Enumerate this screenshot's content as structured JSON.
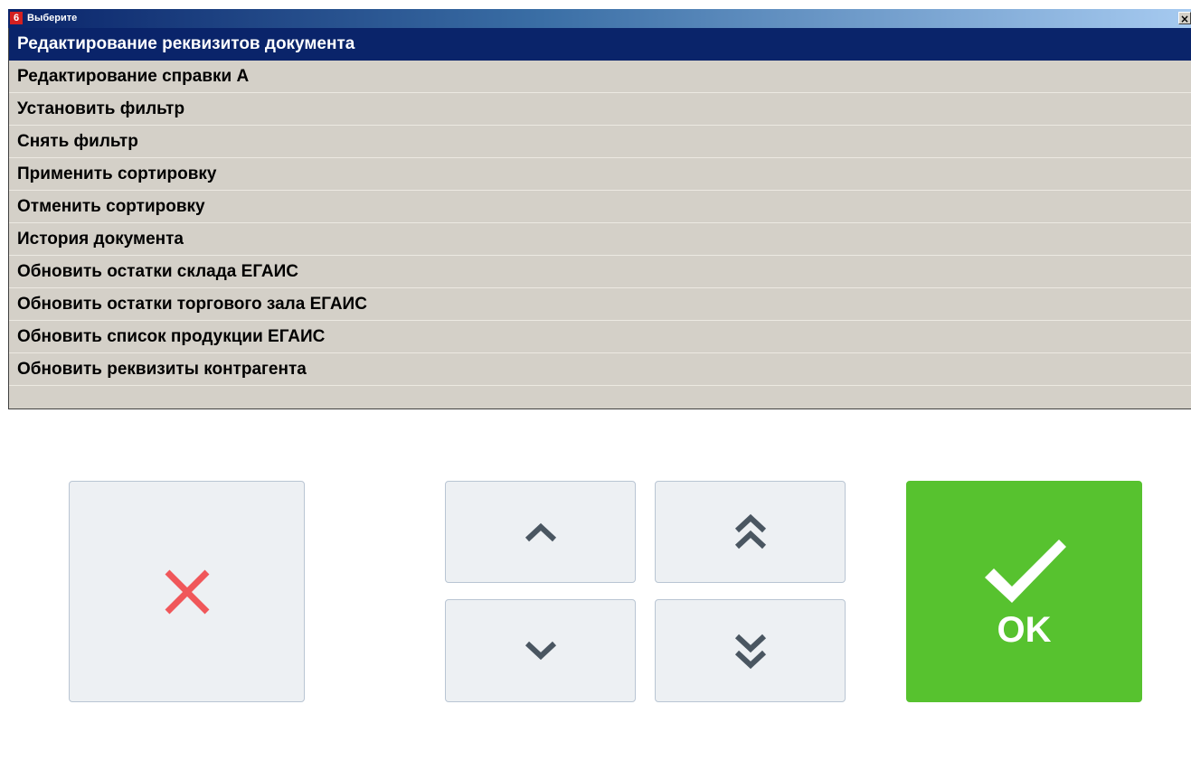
{
  "window": {
    "badge": "6",
    "title": "Выберите",
    "close_glyph": "×"
  },
  "menu": {
    "selected_index": 0,
    "items": [
      {
        "label": "Редактирование реквизитов документа"
      },
      {
        "label": "Редактирование справки А"
      },
      {
        "label": "Установить фильтр"
      },
      {
        "label": "Снять фильтр"
      },
      {
        "label": "Применить сортировку"
      },
      {
        "label": "Отменить сортировку"
      },
      {
        "label": "История документа"
      },
      {
        "label": "Обновить остатки склада ЕГАИС"
      },
      {
        "label": "Обновить остатки торгового зала ЕГАИС"
      },
      {
        "label": "Обновить список продукции ЕГАИС"
      },
      {
        "label": "Обновить реквизиты контрагента"
      }
    ]
  },
  "buttons": {
    "cancel": {
      "icon": "close-x-icon"
    },
    "up": {
      "icon": "chevron-up-icon"
    },
    "page_up": {
      "icon": "double-chevron-up-icon"
    },
    "down": {
      "icon": "chevron-down-icon"
    },
    "page_down": {
      "icon": "double-chevron-down-icon"
    },
    "ok": {
      "icon": "checkmark-icon",
      "label": "OK"
    }
  },
  "colors": {
    "title_bar_start": "#0a246a",
    "selection": "#0a246a",
    "list_background": "#d4d0c8",
    "button_background": "#edf0f3",
    "cancel_icon": "#f0575a",
    "arrow_icon": "#4a5661",
    "ok_background": "#57c22f"
  }
}
